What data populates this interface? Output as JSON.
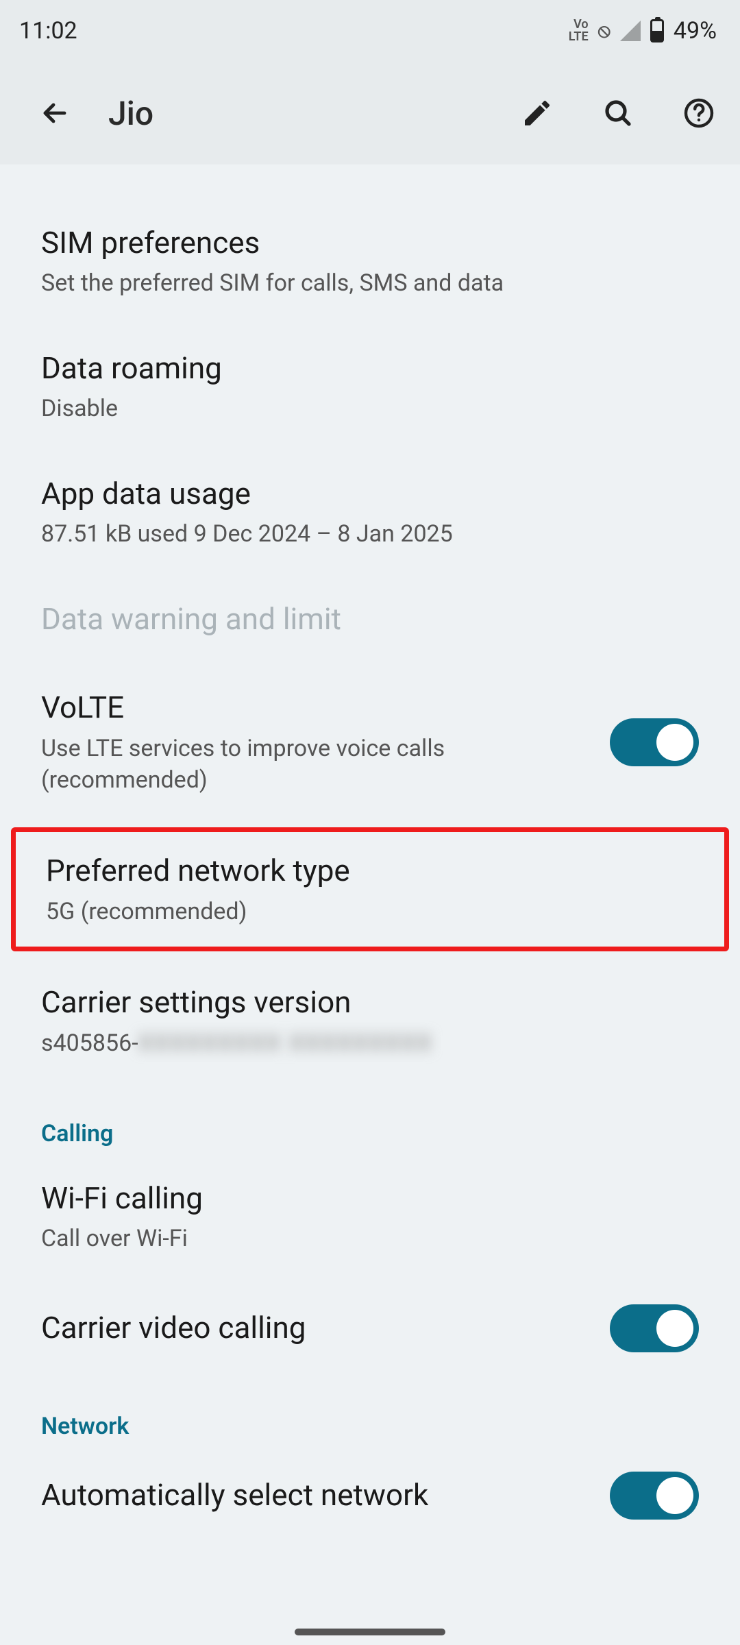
{
  "status": {
    "time": "11:02",
    "volte_badge": "Vo\nLTE",
    "location_badge": "⦸",
    "battery_percent_label": "49%",
    "battery_fill_percent": 49
  },
  "header": {
    "title": "Jio"
  },
  "items": {
    "sim_pref": {
      "title": "SIM preferences",
      "sub": "Set the preferred SIM for calls, SMS and data"
    },
    "roaming": {
      "title": "Data roaming",
      "sub": "Disable"
    },
    "usage": {
      "title": "App data usage",
      "sub": "87.51 kB used 9 Dec 2024 – 8 Jan 2025"
    },
    "data_limit": {
      "title": "Data warning and limit"
    },
    "volte": {
      "title": "VoLTE",
      "sub": "Use LTE services to improve voice calls (recommended)",
      "on": true
    },
    "pref_net": {
      "title": "Preferred network type",
      "sub": "5G (recommended)"
    },
    "carrier_ver": {
      "title": "Carrier settings version",
      "sub_prefix": "s405856-",
      "sub_redacted": "XXXXXXXXX XXXXXXXXX"
    },
    "wifi_call": {
      "title": "Wi-Fi calling",
      "sub": "Call over Wi-Fi"
    },
    "video_call": {
      "title": "Carrier video calling",
      "on": true
    },
    "auto_net": {
      "title": "Automatically select network",
      "on": true
    }
  },
  "sections": {
    "calling": "Calling",
    "network": "Network"
  }
}
